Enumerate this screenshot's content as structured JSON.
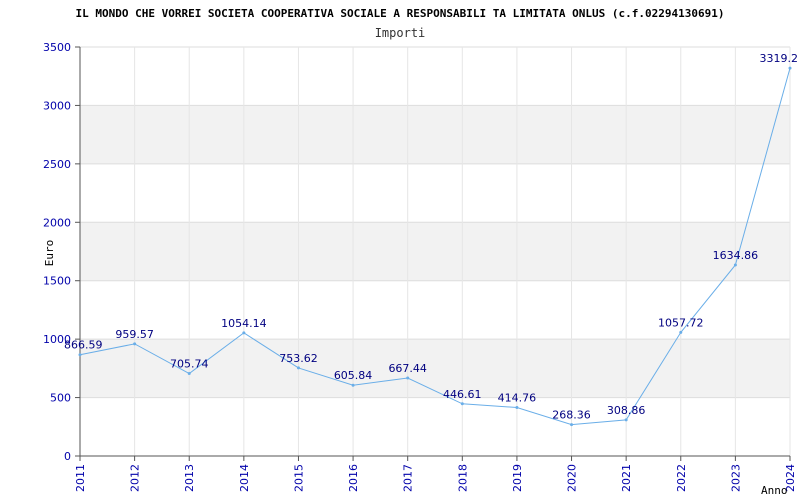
{
  "chart_data": {
    "type": "line",
    "title": "IL MONDO CHE VORREI SOCIETA COOPERATIVA SOCIALE A RESPONSABILI TA LIMITATA ONLUS (c.f.02294130691)",
    "subtitle": "Importi",
    "xlabel": "Anno",
    "ylabel": "Euro",
    "x": [
      "2011",
      "2012",
      "2013",
      "2014",
      "2015",
      "2016",
      "2017",
      "2018",
      "2019",
      "2020",
      "2021",
      "2022",
      "2023",
      "2024"
    ],
    "series": [
      {
        "values": [
          866.59,
          959.57,
          705.74,
          1054.14,
          753.62,
          605.84,
          667.44,
          446.61,
          414.76,
          268.36,
          308.86,
          1057.72,
          1634.86,
          3319.2
        ],
        "labels": [
          "866.59",
          "959.57",
          "705.74",
          "1054.14",
          "753.62",
          "605.84",
          "667.44",
          "446.61",
          "414.76",
          "268.36",
          "308.86",
          "1057.72",
          "1634.86",
          "3319.2"
        ]
      }
    ],
    "ylim": [
      0,
      3500
    ],
    "yticks": [
      "0",
      "500",
      "1000",
      "1500",
      "2000",
      "2500",
      "3000",
      "3500"
    ],
    "grid": true,
    "band_color": "#f2f2f2",
    "line_color": "#6aaee8",
    "tick_color": "#0000aa",
    "label_color": "#000080"
  }
}
